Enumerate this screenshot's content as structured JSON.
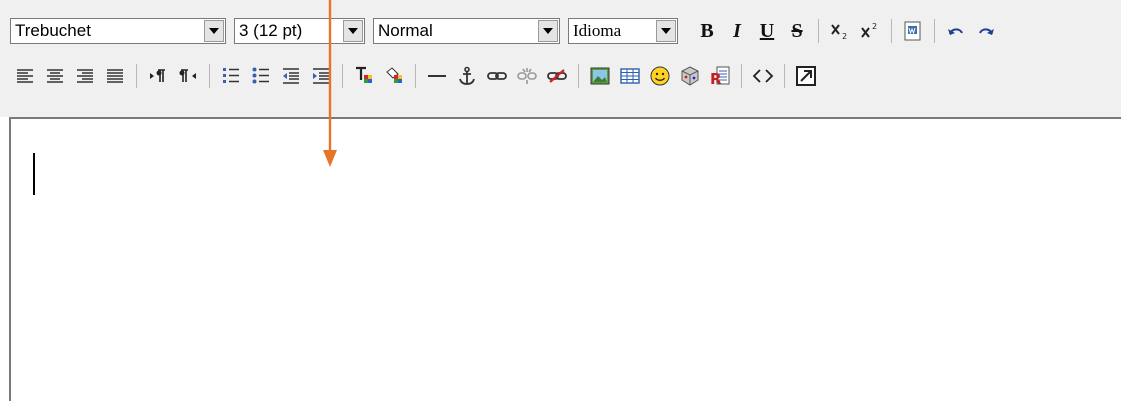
{
  "toolbar": {
    "font_family": "Trebuchet",
    "font_size": "3 (12 pt)",
    "paragraph_format": "Normal",
    "language": "Idioma",
    "bold_label": "B",
    "italic_label": "I",
    "underline_label": "U",
    "strike_label": "S"
  },
  "colors": {
    "toolbar_bg": "#f1f0f0",
    "annotation_arrow": "#e8742a"
  }
}
